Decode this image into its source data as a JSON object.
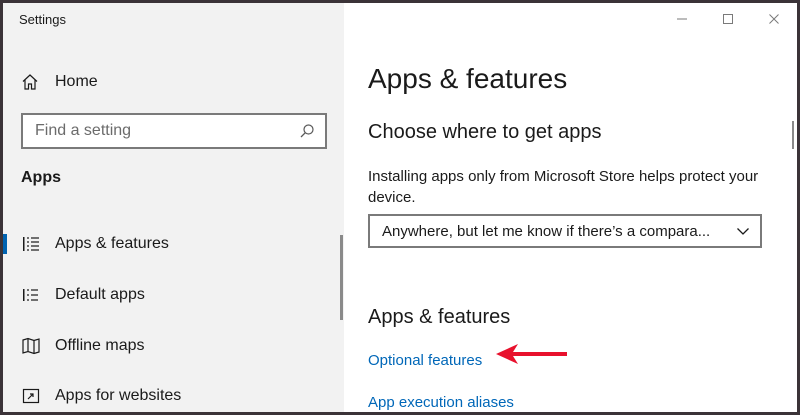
{
  "window": {
    "title": "Settings"
  },
  "sidebar": {
    "home_label": "Home",
    "search_placeholder": "Find a setting",
    "section_label": "Apps",
    "items": [
      {
        "label": "Apps & features",
        "icon": "list-icon",
        "selected": true
      },
      {
        "label": "Default apps",
        "icon": "default-apps-icon",
        "selected": false
      },
      {
        "label": "Offline maps",
        "icon": "map-icon",
        "selected": false
      },
      {
        "label": "Apps for websites",
        "icon": "web-link-icon",
        "selected": false
      }
    ]
  },
  "main": {
    "page_title": "Apps & features",
    "choose_heading": "Choose where to get apps",
    "info_text": "Installing apps only from Microsoft Store helps protect your device.",
    "source_dropdown_value": "Anywhere, but let me know if there’s a compara...",
    "features_heading": "Apps & features",
    "links": {
      "optional_features": "Optional features",
      "app_execution_aliases": "App execution aliases"
    }
  },
  "colors": {
    "accent": "#0063b1",
    "link": "#0067b8",
    "annotation_arrow": "#e8112d",
    "sidebar_bg": "#f2f2f2"
  }
}
